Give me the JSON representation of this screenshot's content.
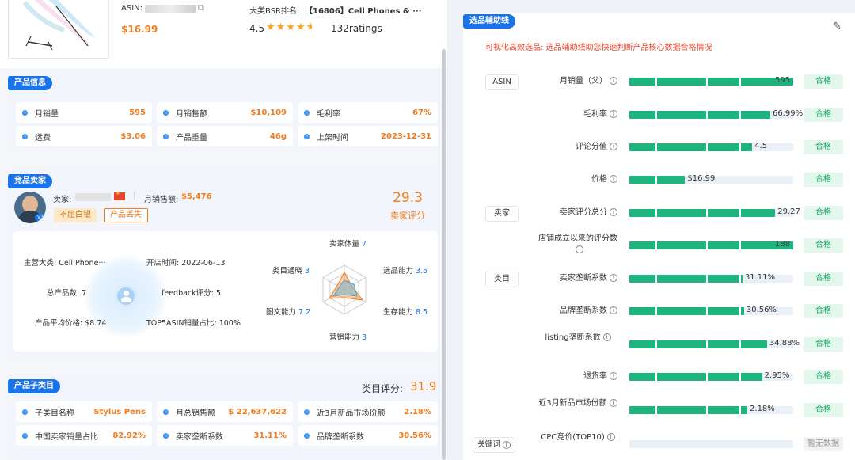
{
  "product": {
    "asin_label": "ASIN:",
    "price": "$16.99",
    "bsr_label": "大类BSR排名:",
    "bsr_value": "【16806】Cell Phones & ···",
    "rating": "4.5",
    "rating_stars": 4.5,
    "ratings_count": "132ratings"
  },
  "product_info": {
    "badge": "产品信息",
    "cells": [
      {
        "label": "月销量",
        "value": "595"
      },
      {
        "label": "月销售额",
        "value": "$10,109"
      },
      {
        "label": "毛利率",
        "value": "67%"
      },
      {
        "label": "运费",
        "value": "$3.06"
      },
      {
        "label": "产品重量",
        "value": "46g"
      },
      {
        "label": "上架时间",
        "value": "2023-12-31"
      }
    ]
  },
  "seller": {
    "badge": "竞品卖家",
    "seller_label": "卖家:",
    "monthly_sales_label": "月销售额:",
    "monthly_sales_value": "$5,476",
    "tags": [
      "不屈白银",
      "产品丢失"
    ],
    "score": "29.3",
    "score_label": "卖家评分",
    "details": {
      "main_category": "主营大类: Cell Phone···",
      "open_time": "开店时间: 2022-06-13",
      "total_products": "总产品数: 7",
      "feedback": "feedback评分: 5",
      "avg_price": "产品平均价格: $8.74",
      "top5": "TOP5ASIN销量占比: 100%"
    },
    "radar": {
      "axes": [
        {
          "label": "卖家体量",
          "value": "7"
        },
        {
          "label": "选品能力",
          "value": "3.5"
        },
        {
          "label": "生存能力",
          "value": "8.5"
        },
        {
          "label": "营销能力",
          "value": "3"
        },
        {
          "label": "图文能力",
          "value": "7.2"
        },
        {
          "label": "类目通晓",
          "value": "3"
        }
      ]
    }
  },
  "subcategory": {
    "badge": "产品子类目",
    "score_label": "类目评分:",
    "score_value": "31.9",
    "cells": [
      {
        "label": "子类目名称",
        "value": "Stylus Pens"
      },
      {
        "label": "月总销售额",
        "value": "$ 22,637,622"
      },
      {
        "label": "近3月新品市场份额",
        "value": "2.18%"
      },
      {
        "label": "中国卖家销量占比",
        "value": "82.92%"
      },
      {
        "label": "卖家垄断系数",
        "value": "31.11%"
      },
      {
        "label": "品牌垄断系数",
        "value": "30.56%"
      }
    ]
  },
  "guide": {
    "badge": "选品辅助线",
    "subtitle": "可视化高效选品: 选品辅助线助您快速判断产品核心数据合格情况",
    "groups": [
      "ASIN",
      "卖家",
      "类目",
      "关键词"
    ],
    "rows": [
      {
        "label": "月销量（父）",
        "value": "595",
        "fill": 1.0,
        "status": "合格"
      },
      {
        "label": "毛利率",
        "value": "66.99%",
        "fill": 0.86,
        "status": "合格"
      },
      {
        "label": "评论分值",
        "value": "4.5",
        "fill": 0.75,
        "status": "合格"
      },
      {
        "label": "价格",
        "value": "$16.99",
        "fill": 0.34,
        "status": "合格"
      },
      {
        "label": "卖家评分总分",
        "value": "29.27",
        "fill": 0.89,
        "status": "合格"
      },
      {
        "label": "店铺成立以来的评分数",
        "value": "188",
        "fill": 1.0,
        "status": "合格"
      },
      {
        "label": "卖家垄断系数",
        "value": "31.11%",
        "fill": 0.69,
        "status": "合格"
      },
      {
        "label": "品牌垄断系数",
        "value": "30.56%",
        "fill": 0.7,
        "status": "合格"
      },
      {
        "label": "listing垄断系数",
        "value": "34.88%",
        "fill": 0.84,
        "status": "合格"
      },
      {
        "label": "退货率",
        "value": "2.95%",
        "fill": 0.81,
        "status": "合格"
      },
      {
        "label": "近3月新品市场份额",
        "value": "2.18%",
        "fill": 0.72,
        "status": "合格"
      },
      {
        "label": "CPC竞价(TOP10)",
        "value": "",
        "fill": 0,
        "status": "暂无数据"
      }
    ]
  },
  "colors": {
    "accent": "#1a73e8",
    "orange": "#f07c1e",
    "green": "#1db47d",
    "red": "#e8452c"
  },
  "icons": {
    "copy": "copy-icon",
    "edit": "edit-icon",
    "info": "info-icon",
    "star": "star-icon"
  }
}
